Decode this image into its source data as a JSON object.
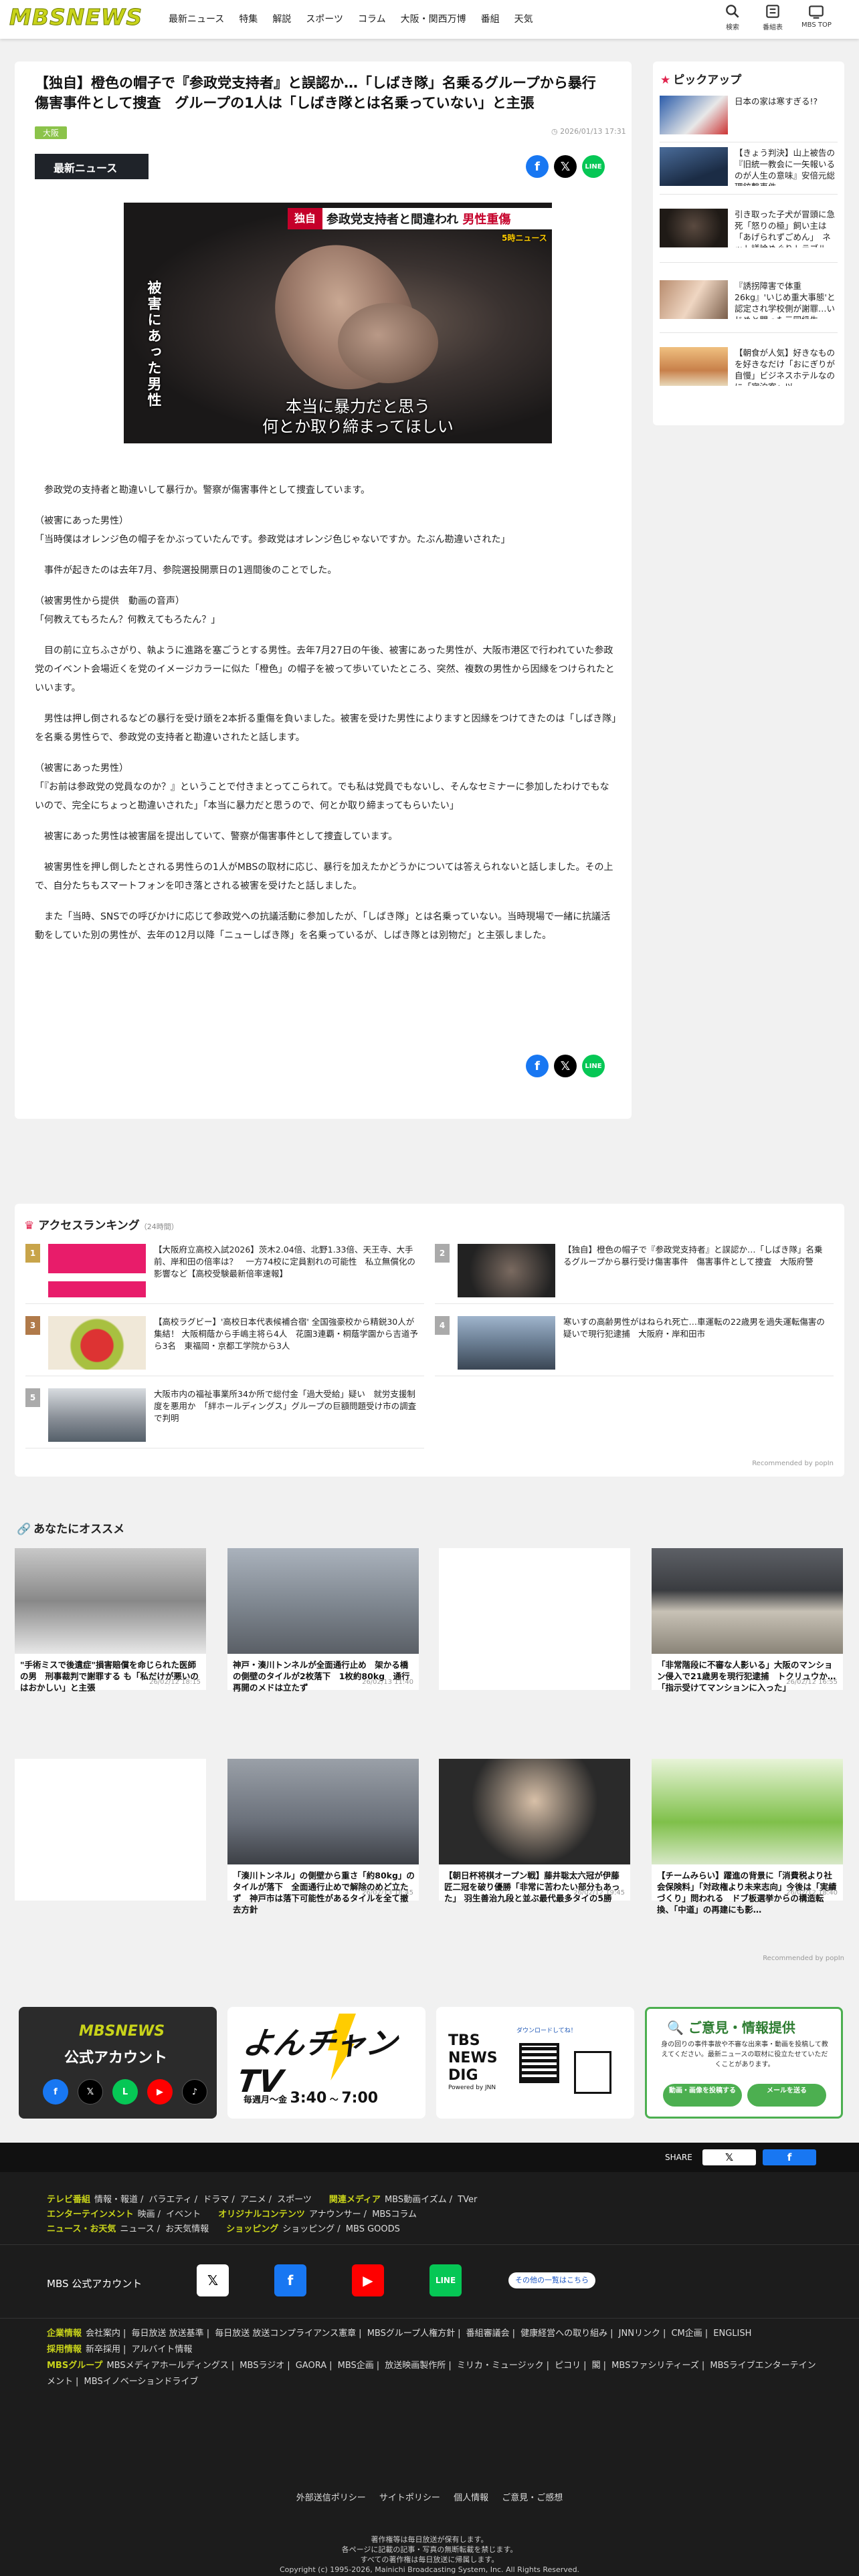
{
  "header": {
    "logo": "MBSNEWS",
    "nav": [
      "最新ニュース",
      "特集",
      "解説",
      "スポーツ",
      "コラム",
      "大阪・関西万博",
      "番組",
      "天気"
    ],
    "icons": [
      {
        "name": "search-icon",
        "label": "検索"
      },
      {
        "name": "tv-program-icon",
        "label": "番組表"
      },
      {
        "name": "tv-icon",
        "label": "MBS TOP"
      }
    ]
  },
  "article": {
    "headline": "【独自】橙色の帽子で『参政党支持者』と誤認か…「しばき隊」名乗るグループから暴行　傷害事件として捜査　グループの1人は「しばき隊とは名乗っていない」と主張",
    "area_tag": "大阪",
    "published": "2026/01/13 17:31",
    "category_badge": "最新ニュース",
    "photo": {
      "vertical_caption": "被害にあった男性",
      "band_tag": "独自",
      "band_text": "参政党支持者と間違われ",
      "band_red": "男性重傷",
      "brand": "5時ニュース",
      "subtitle_line1": "本当に暴力だと思う",
      "subtitle_line2": "何とか取り締まってほしい"
    },
    "paragraphs": [
      "　参政党の支持者と勘違いして暴行か。警察が傷害事件として捜査しています。",
      "",
      "（被害にあった男性）",
      "「当時僕はオレンジ色の帽子をかぶっていたんです。参政党はオレンジ色じゃないですか。たぶん勘違いされた」",
      "",
      "　事件が起きたのは去年7月、参院選投開票日の1週間後のことでした。",
      "",
      "（被害男性から提供　動画の音声）",
      "「何教えてもろたん？何教えてもろたん？」",
      "",
      "　目の前に立ちふさがり、執ように進路を塞ごうとする男性。去年7月27日の午後、被害にあった男性が、大阪市港区で行われていた参政党のイベント会場近くを党のイメージカラーに似た「橙色」の帽子を被って歩いていたところ、突然、複数の男性から因縁をつけられたといいます。",
      "",
      "　男性は押し倒されるなどの暴行を受け頭を2本折る重傷を負いました。被害を受けた男性によりますと因縁をつけてきたのは「しばき隊」を名乗る男性らで、参政党の支持者と勘違いされたと話します。",
      "",
      "（被害にあった男性）",
      "「『お前は参政党の党員なのか？』ということで付きまとってこられて。でも私は党員でもないし、そんなセミナーに参加したわけでもないので、完全にちょっと勘違いされた」「本当に暴力だと思うので、何とか取り締まってもらいたい」",
      "",
      "　被害にあった男性は被害届を提出していて、警察が傷害事件として捜査しています。",
      "",
      "　被害男性を押し倒したとされる男性らの1人がMBSの取材に応じ、暴行を加えたかどうかについては答えられないと話しました。その上で、自分たちもスマートフォンを叩き落とされる被害を受けたと話しました。",
      "",
      "　また「当時、SNSでの呼びかけに応じて参政党への抗議活動に参加したが、「しばき隊」とは名乗っていない。当時現場で一緒に抗議活動をしていた別の男性が、去年の12月以降「ニューしばき隊」を名乗っているが、しばき隊とは別物だ」と主張しました。"
    ]
  },
  "pickup": {
    "title": "ピックアップ",
    "items": [
      "日本の家は寒すぎる!?",
      "【きょう判決】山上被告の『旧統一教会に一矢報いるのが人生の意味』安倍元総理銃撃事件…",
      "引き取った子犬が冒頭に急死「怒りの極」飼い主は「あげられずごめん」　ネット議論めぐりトラブル…",
      "『誘拐障害で体重26kg』'いじめ重大事態'と認定され学校側が謝罪…いじめと闘った元同級生…",
      "【朝食が人気】好きなものを好きなだけ「おにぎりが自慢」ビジネスホテルなのに「宿泊客」以…"
    ]
  },
  "ranking": {
    "title": "アクセスランキング",
    "period": "（24時間）",
    "items": [
      {
        "num": "1",
        "text": "【大阪府立高校入試2026】茨木2.04倍、北野1.33倍、天王寺、大手前、岸和田の倍率は？　一方74校に定員割れの可能性　私立無償化の影響など【高校受験最新倍率速報】"
      },
      {
        "num": "2",
        "text": "【独自】橙色の帽子で『参政党支持者』と誤認か…「しばき隊」名乗るグループから暴行受け傷害事件　傷害事件として捜査　大阪府警"
      },
      {
        "num": "3",
        "text": "【高校ラグビー】'高校日本代表候補合宿' 全国強豪校から精鋭30人が集結！ 大阪桐蔭から手嶋主将ら4人　花園3連覇・桐蔭学園から吉道予ら3名　東福岡・京都工学院から3人"
      },
      {
        "num": "4",
        "text": "寒いすの高齢男性がはねられ死亡…車運転の22歳男を過失運転傷害の疑いで現行犯逮捕　大阪府・岸和田市"
      },
      {
        "num": "5",
        "text": "大阪市内の福祉事業所34か所で総付金「過大受給」疑い　就労支援制度を悪用か　「絆ホールディングス」グループの巨額問題受け市の調査で判明"
      }
    ],
    "credit": "Recommended by popIn"
  },
  "recommend": {
    "title": "あなたにオススメ",
    "cards": [
      {
        "text": "\"手術ミスで後遺症\"損害賠償を命じられた医師の男　刑事裁判で謝罪する も「私だけが悪いのはおかしい」と主張",
        "date": "26/02/12 18:15"
      },
      {
        "text": "神戸・湊川トンネルが全面通行止め　架かる橋の側壁のタイルが2枚落下　1枚約80kg　通行再開のメドは立たず",
        "date": "26/02/13 11:40"
      },
      {
        "text": "",
        "date": ""
      },
      {
        "text": "「非常階段に不審な人影いる」大阪のマンション侵入で21歳男を現行犯逮捕　トクリュウか…「指示受けてマンションに入った」",
        "date": "26/02/12 16:55"
      },
      {
        "text": "",
        "date": ""
      },
      {
        "text": "「湊川トンネル」の側壁から重さ「約80kg」のタイルが落下　全面通行止めで解除のめど立たず　神戸市は落下可能性があるタイルを全て撤去方針",
        "date": "26/02/13 18:45"
      },
      {
        "text": "【朝日杯将棋オープン戦】藤井聡太六冠が伊藤匠二冠を破り優勝「非常に苦わたい部分もあった」 羽生善治九段と並ぶ最代最多タイの5勝",
        "date": "26/02/12 19:45"
      },
      {
        "text": "【チームみらい】躍進の背景に「消費税より社会保険料」「対政権より未来志向」今後は「実績づくり」問われる　ドブ板選挙からの構造転換、「中道」の再建にも影…",
        "date": "26/02/12 18:40"
      }
    ],
    "credit": "Recommended by popIn"
  },
  "banners": {
    "official": {
      "brand": "MBSNEWS",
      "title": "公式アカウント"
    },
    "yonchan": {
      "title": "よんチャンTV",
      "time_prefix": "毎週月～金",
      "time_start": "3:40",
      "time_end": "7:00"
    },
    "tbs": {
      "title_line1": "TBS",
      "title_line2": "NEWS",
      "title_line3": "DIG",
      "sub": "Powered by JNN",
      "qr_caption": "ダウンロードしてね！"
    },
    "opinion": {
      "title": "ご意見・情報提供",
      "desc": "身の回りの事件事故や不審な出来事・動画を投稿して教えてください。最新ニュースの取材に役立たせていただくことがあります。",
      "btn1": "動画・画像を投稿する",
      "btn2": "メールを送る"
    }
  },
  "share_bar": {
    "label": "SHARE"
  },
  "footer": {
    "rows": [
      {
        "cat": "テレビ番組",
        "items": [
          "情報・報道",
          "バラエティ",
          "ドラマ",
          "アニメ",
          "スポーツ"
        ],
        "cat2": "関連メディア",
        "items2": [
          "MBS動画イズム",
          "TVer"
        ]
      },
      {
        "cat": "エンターテインメント",
        "items": [
          "映画",
          "イベント"
        ],
        "cat2": "オリジナルコンテンツ",
        "items2": [
          "アナウンサー",
          "MBSコラム"
        ]
      },
      {
        "cat": "ニュース・お天気",
        "items": [
          "ニュース",
          "お天気情報"
        ],
        "cat2": "ショッピング",
        "items2": [
          "ショッピング",
          "MBS GOODS"
        ]
      }
    ],
    "account_label": "MBS 公式アカウント",
    "account_more": "その他の一覧はこちら",
    "corp_rows": [
      {
        "cat": "企業情報",
        "items": [
          "会社案内",
          "毎日放送 放送基準",
          "毎日放送 放送コンプライアンス憲章",
          "MBSグループ人権方針",
          "番組審議会",
          "健康経営への取り組み",
          "JNNリンク",
          "CM企画",
          "ENGLISH"
        ]
      },
      {
        "cat": "採用情報",
        "items": [
          "新卒採用",
          "アルバイト情報"
        ]
      },
      {
        "cat": "MBSグループ",
        "items": [
          "MBSメディアホールディングス",
          "MBSラジオ",
          "GAORA",
          "MBS企画",
          "放送映画製作所",
          "ミリカ・ミュージック",
          "ピコリ",
          "閣",
          "MBSファシリティーズ",
          "MBSライブエンターテインメント",
          "MBSイノベーションドライブ"
        ]
      }
    ],
    "bottom_links": [
      "外部送信ポリシー",
      "サイトポリシー",
      "個人情報",
      "ご意見・ご感想"
    ],
    "copyright_lines": [
      "著作権等は毎日放送が保有します。",
      "各ページに記載の記事・写真の無断転載を禁じます。",
      "すべての著作権は毎日放送に帰属します。",
      "Copyright (c) 1995-2026, Mainichi Broadcasting System, Inc. All Rights Reserved."
    ]
  },
  "colors": {
    "brand_lime": "#c8d31a",
    "accent_pink": "#e0244e",
    "tag_green": "#8bc34a",
    "facebook": "#1877f2",
    "line": "#06c755"
  }
}
